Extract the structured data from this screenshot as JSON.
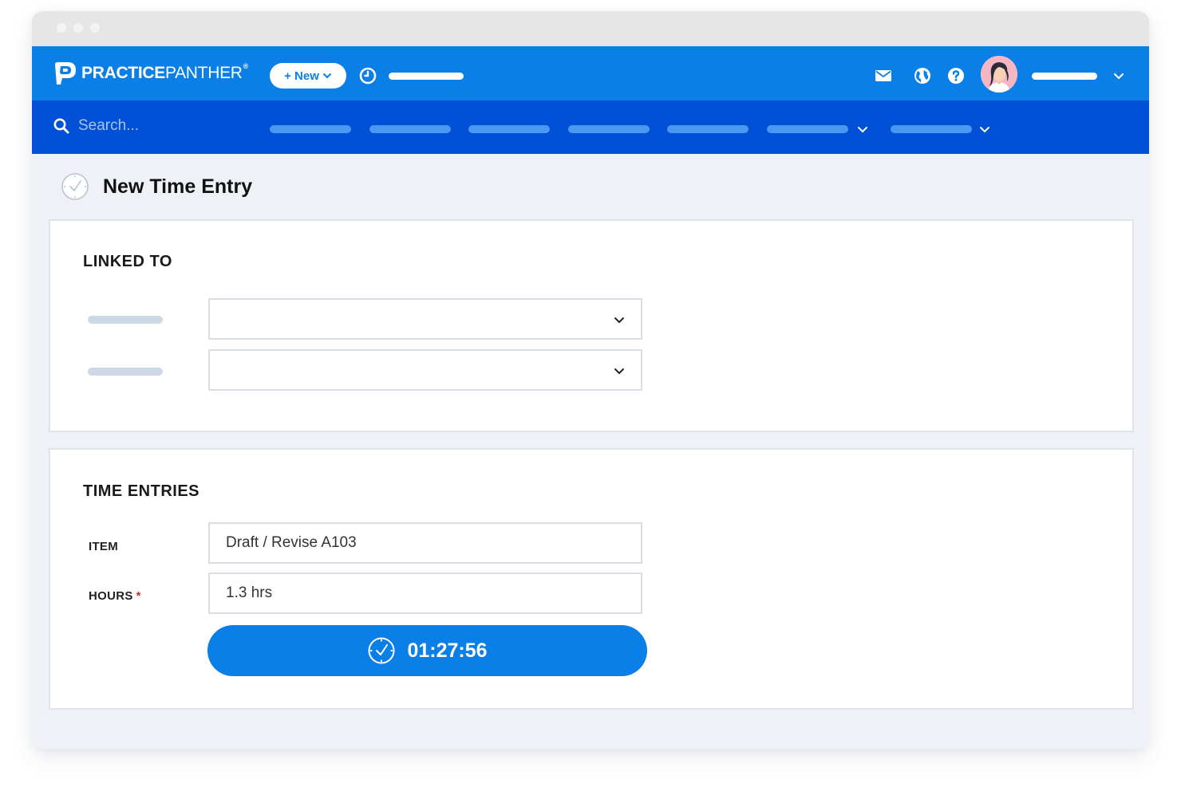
{
  "brand": {
    "name_bold": "PRACTICE",
    "name_light": "PANTHER",
    "trademark": "®"
  },
  "topbar": {
    "new_button_label": "+ New",
    "icons": [
      "clock-icon",
      "mail-icon",
      "globe-icon",
      "help-icon"
    ]
  },
  "navbar": {
    "search_placeholder": "Search..."
  },
  "page": {
    "title": "New Time Entry"
  },
  "linked_to": {
    "heading": "LINKED TO"
  },
  "time_entries": {
    "heading": "TIME ENTRIES",
    "item_label": "ITEM",
    "item_value": "Draft / Revise A103",
    "hours_label": "HOURS",
    "hours_required_mark": "*",
    "hours_value": "1.3 hrs",
    "timer_value": "01:27:56"
  },
  "colors": {
    "primary_blue": "#0a7fe8",
    "nav_blue": "#0250d6",
    "required_red": "#e02424"
  }
}
